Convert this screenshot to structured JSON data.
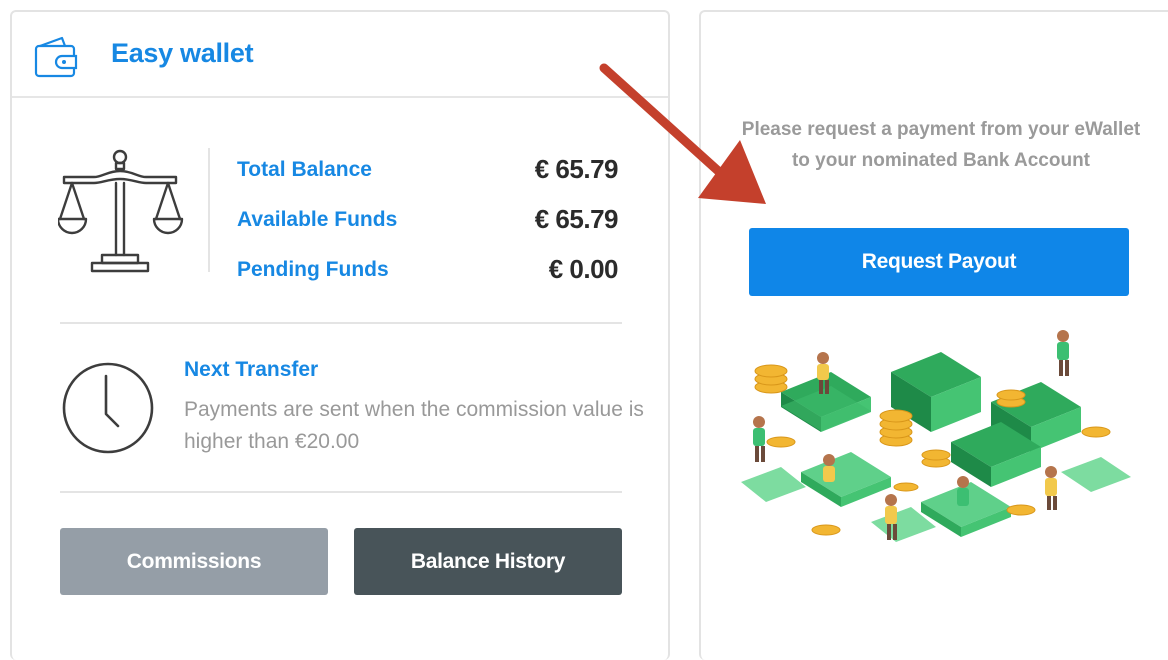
{
  "wallet": {
    "title": "Easy wallet",
    "balances": [
      {
        "label": "Total Balance",
        "value": "€ 65.79"
      },
      {
        "label": "Available Funds",
        "value": "€ 65.79"
      },
      {
        "label": "Pending Funds",
        "value": "€ 0.00"
      }
    ],
    "next_transfer": {
      "title": "Next Transfer",
      "text": "Payments are sent when the commission value is higher than €20.00"
    },
    "buttons": {
      "commissions": "Commissions",
      "balance_history": "Balance History"
    }
  },
  "payout": {
    "text": "Please request a payment from your eWallet to your nominated Bank Account",
    "button": "Request Payout"
  },
  "colors": {
    "accent": "#1788e3",
    "payout_button": "#0f86e8",
    "commissions_button": "#959ea7",
    "history_button": "#485459",
    "arrow": "#c4402c"
  },
  "icons": {
    "header": "wallet-icon",
    "balance": "scale-icon",
    "transfer": "clock-icon"
  }
}
